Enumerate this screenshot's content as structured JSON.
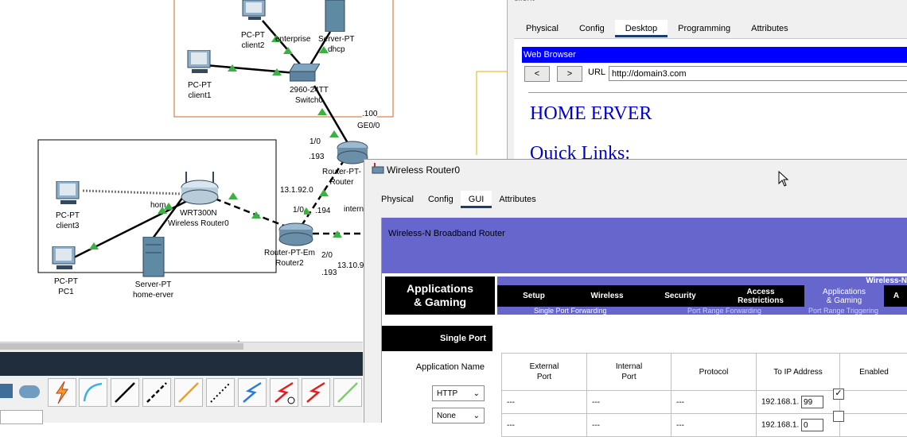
{
  "topology": {
    "devices": {
      "client2": {
        "type": "PC-PT",
        "name": "client2"
      },
      "server_dhcp": {
        "type": "Server-PT",
        "name": "dhcp"
      },
      "client1": {
        "type": "PC-PT",
        "name": "client1"
      },
      "switch": {
        "type": "2960-24TT",
        "name": "Switch0"
      },
      "router_top": {
        "type": "Router-PT-",
        "name": "Router"
      },
      "wireless_router": {
        "type": "WRT300N",
        "name": "Wireless Router0"
      },
      "client3": {
        "type": "PC-PT",
        "name": "client3"
      },
      "pc1": {
        "type": "PC-PT",
        "name": "PC1"
      },
      "home_server": {
        "type": "Server-PT",
        "name": "home-erver"
      },
      "router2": {
        "type": "Router-PT-Em",
        "name": "Router2"
      }
    },
    "labels": {
      "enterprise": "enterprise",
      "if_100": ".100",
      "ge00": "GE0/0",
      "if_1_0_top": "1/0",
      "if_193_top": ".193",
      "net_13_1_92": "13.1.92.0",
      "if_1_0_r2": "1/0",
      "if_194": ".194",
      "intern": "intern",
      "home": "hom",
      "if_2_0": "2/0",
      "net_13_10": "13.10.9",
      "if_193_r2": ".193"
    }
  },
  "client_window": {
    "title": "client",
    "tabs": [
      "Physical",
      "Config",
      "Desktop",
      "Programming",
      "Attributes"
    ],
    "active_tab": "Desktop",
    "browser": {
      "title": "Web Browser",
      "back_label": "<",
      "forward_label": ">",
      "url_label": "URL",
      "url_value": "http://domain3.com",
      "heading": "HOME ERVER",
      "subheading": "Quick Links:"
    }
  },
  "router_window": {
    "title": "Wireless Router0",
    "tabs": [
      "Physical",
      "Config",
      "GUI",
      "Attributes"
    ],
    "active_tab": "GUI",
    "gui": {
      "brand": "Wireless-N Broadband Router",
      "model_partial": "Wireless-N",
      "section_title_line1": "Applications",
      "section_title_line2": "& Gaming",
      "menu": [
        {
          "line1": "Setup",
          "line2": ""
        },
        {
          "line1": "Wireless",
          "line2": ""
        },
        {
          "line1": "Security",
          "line2": ""
        },
        {
          "line1": "Access",
          "line2": "Restrictions"
        },
        {
          "line1": "Applications",
          "line2": "& Gaming"
        },
        {
          "line1": "A",
          "line2": ""
        }
      ],
      "submenu": [
        "Single Port Forwarding",
        "Port Range Forwarding",
        "Port Range Triggering"
      ],
      "single_port_label": "Single Port",
      "app_name_label": "Application Name",
      "columns": {
        "external_port_1": "External",
        "external_port_2": "Port",
        "internal_port_1": "Internal",
        "internal_port_2": "Port",
        "protocol": "Protocol",
        "to_ip": "To IP Address",
        "enabled": "Enabled"
      },
      "rows": [
        {
          "app": "HTTP",
          "external": "---",
          "internal": "---",
          "protocol": "---",
          "ip_prefix": "192.168.1.",
          "ip_last": "99",
          "enabled": true
        },
        {
          "app": "None",
          "external": "---",
          "internal": "---",
          "protocol": "---",
          "ip_prefix": "192.168.1.",
          "ip_last": "0",
          "enabled": false
        }
      ]
    }
  },
  "colors": {
    "link_black": "#000000",
    "link_green_triangle": "#3cb043",
    "browser_title_blue": "#0000ff",
    "router_brand_purple": "#6666cc",
    "enterprise_box": "#d2691e"
  }
}
